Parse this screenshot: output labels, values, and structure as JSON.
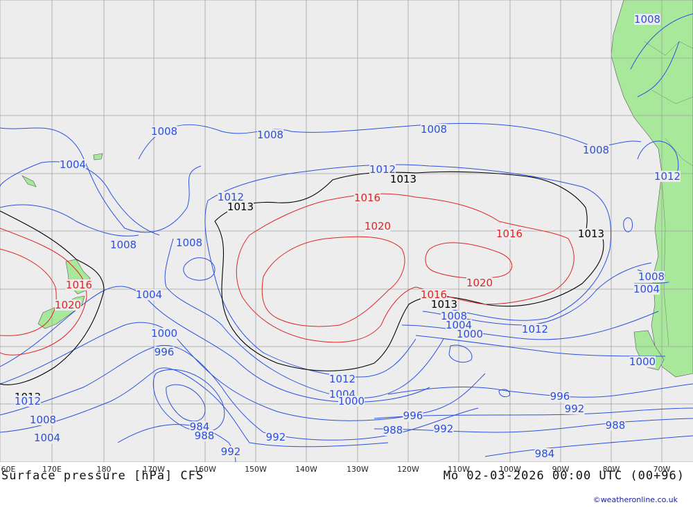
{
  "title": "Surface pressure [hPa] CFS",
  "valid_time": "Mo 02-03-2026 00:00 UTC (00+96)",
  "credit": "©weatheronline.co.uk",
  "longitude_labels": [
    "60E",
    "170E",
    "180",
    "170W",
    "160W",
    "150W",
    "140W",
    "130W",
    "120W",
    "110W",
    "100W",
    "90W",
    "80W",
    "70W"
  ],
  "colors": {
    "ocean": "#ededed",
    "land": "#a8e89a",
    "grid": "#a0a0a0",
    "isobar_low": "#2b4fe0",
    "isobar_1013": "#000000",
    "isobar_high": "#e02424"
  },
  "isobar_labels": [
    {
      "text": "1008"
    },
    {
      "text": "1008"
    },
    {
      "text": "1008"
    },
    {
      "text": "1008"
    },
    {
      "text": "1008"
    },
    {
      "text": "1004"
    },
    {
      "text": "1008"
    },
    {
      "text": "1008"
    },
    {
      "text": "1012"
    },
    {
      "text": "1013"
    },
    {
      "text": "1012"
    },
    {
      "text": "1013"
    },
    {
      "text": "1016"
    },
    {
      "text": "1020"
    },
    {
      "text": "1016"
    },
    {
      "text": "1013"
    },
    {
      "text": "1012"
    },
    {
      "text": "1020"
    },
    {
      "text": "1016"
    },
    {
      "text": "1020"
    },
    {
      "text": "1016"
    },
    {
      "text": "1013"
    },
    {
      "text": "1004"
    },
    {
      "text": "1008"
    },
    {
      "text": "1004"
    },
    {
      "text": "1000"
    },
    {
      "text": "1012"
    },
    {
      "text": "1000"
    },
    {
      "text": "996"
    },
    {
      "text": "1012"
    },
    {
      "text": "1004"
    },
    {
      "text": "1000"
    },
    {
      "text": "1000"
    },
    {
      "text": "1013"
    },
    {
      "text": "1012"
    },
    {
      "text": "1008"
    },
    {
      "text": "1004"
    },
    {
      "text": "984"
    },
    {
      "text": "988"
    },
    {
      "text": "992"
    },
    {
      "text": "992"
    },
    {
      "text": "996"
    },
    {
      "text": "988"
    },
    {
      "text": "992"
    },
    {
      "text": "996"
    },
    {
      "text": "992"
    },
    {
      "text": "988"
    },
    {
      "text": "984"
    },
    {
      "text": "1008"
    },
    {
      "text": "1004"
    }
  ]
}
